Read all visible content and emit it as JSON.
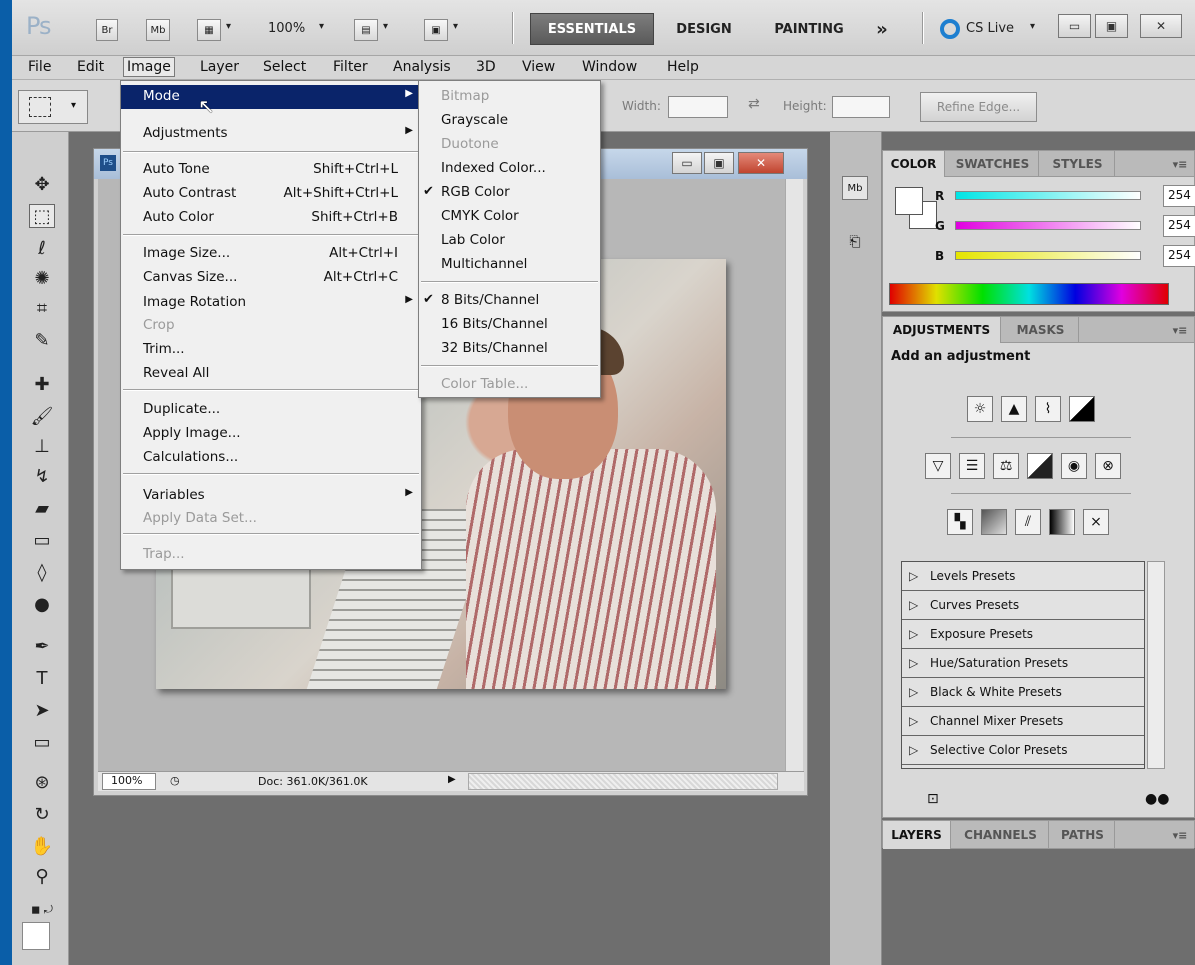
{
  "appbar": {
    "logo": "Ps",
    "br": "Br",
    "mb": "Mb",
    "zoom": "100%",
    "workspaces": [
      "ESSENTIALS",
      "DESIGN",
      "PAINTING"
    ],
    "more": "»",
    "cslive": "CS Live",
    "chevron": "▾"
  },
  "menubar": [
    "File",
    "Edit",
    "Image",
    "Layer",
    "Select",
    "Filter",
    "Analysis",
    "3D",
    "View",
    "Window",
    "Help"
  ],
  "options": {
    "width_label": "Width:",
    "height_label": "Height:",
    "refine_edge": "Refine Edge..."
  },
  "image_menu": {
    "items": [
      {
        "label": "Mode",
        "shortcut": "",
        "submenu": true,
        "highlighted": true
      },
      {
        "label": "Adjustments",
        "shortcut": "",
        "submenu": true
      },
      {
        "label": "Auto Tone",
        "shortcut": "Shift+Ctrl+L"
      },
      {
        "label": "Auto Contrast",
        "shortcut": "Alt+Shift+Ctrl+L"
      },
      {
        "label": "Auto Color",
        "shortcut": "Shift+Ctrl+B"
      },
      {
        "label": "Image Size...",
        "shortcut": "Alt+Ctrl+I"
      },
      {
        "label": "Canvas Size...",
        "shortcut": "Alt+Ctrl+C"
      },
      {
        "label": "Image Rotation",
        "shortcut": "",
        "submenu": true
      },
      {
        "label": "Crop",
        "shortcut": "",
        "disabled": true
      },
      {
        "label": "Trim...",
        "shortcut": ""
      },
      {
        "label": "Reveal All",
        "shortcut": ""
      },
      {
        "label": "Duplicate...",
        "shortcut": ""
      },
      {
        "label": "Apply Image...",
        "shortcut": ""
      },
      {
        "label": "Calculations...",
        "shortcut": ""
      },
      {
        "label": "Variables",
        "shortcut": "",
        "submenu": true
      },
      {
        "label": "Apply Data Set...",
        "shortcut": "",
        "disabled": true
      },
      {
        "label": "Trap...",
        "shortcut": "",
        "disabled": true
      }
    ]
  },
  "mode_menu": {
    "items": [
      {
        "label": "Bitmap",
        "disabled": true
      },
      {
        "label": "Grayscale"
      },
      {
        "label": "Duotone",
        "disabled": true
      },
      {
        "label": "Indexed Color..."
      },
      {
        "label": "RGB Color",
        "checked": true
      },
      {
        "label": "CMYK Color"
      },
      {
        "label": "Lab Color"
      },
      {
        "label": "Multichannel"
      },
      {
        "label": "8 Bits/Channel",
        "checked": true
      },
      {
        "label": "16 Bits/Channel"
      },
      {
        "label": "32 Bits/Channel"
      },
      {
        "label": "Color Table...",
        "disabled": true
      }
    ],
    "check_glyph": "✔"
  },
  "document": {
    "tab_label": "Ps",
    "zoom": "100%",
    "doc_info": "Doc: 361.0K/361.0K"
  },
  "color_panel": {
    "tabs": [
      "COLOR",
      "SWATCHES",
      "STYLES"
    ],
    "channels": [
      {
        "label": "R",
        "value": "254",
        "color": "#00e5e5"
      },
      {
        "label": "G",
        "value": "254",
        "color": "#e000e0"
      },
      {
        "label": "B",
        "value": "254",
        "color": "#e5e500"
      }
    ]
  },
  "adjustments_panel": {
    "tabs": [
      "ADJUSTMENTS",
      "MASKS"
    ],
    "heading": "Add an adjustment",
    "presets": [
      "Levels Presets",
      "Curves Presets",
      "Exposure Presets",
      "Hue/Saturation Presets",
      "Black & White Presets",
      "Channel Mixer Presets",
      "Selective Color Presets"
    ],
    "tri": "▷"
  },
  "layers_panel": {
    "tabs": [
      "LAYERS",
      "CHANNELS",
      "PATHS"
    ]
  },
  "colors": {
    "menu_highlight": "#0a246a",
    "desktop_blue": "#0a5ea8"
  }
}
